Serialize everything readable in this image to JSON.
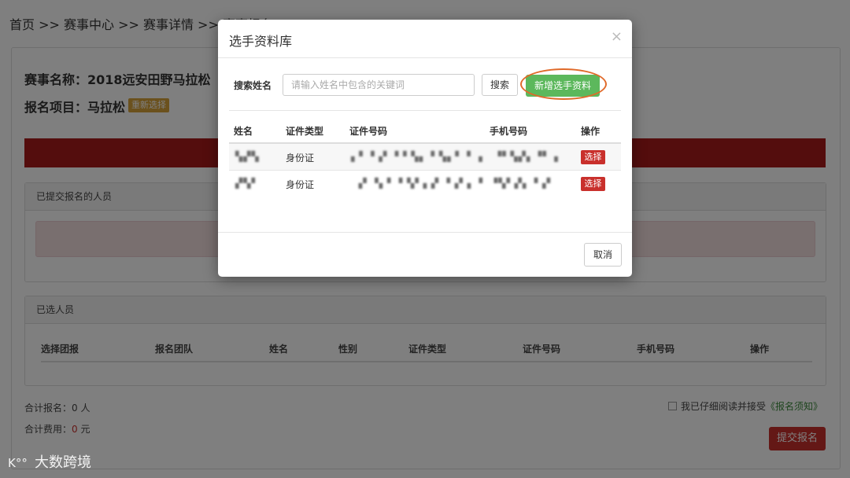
{
  "breadcrumb": "首页 >> 赛事中心 >> 赛事详情 >> 赛事报名",
  "event": {
    "name_line": "赛事名称：2018远安田野马拉松",
    "item_line": "报名项目：马拉松",
    "reselect_label": "重新选择"
  },
  "submitted_panel": {
    "title": "已提交报名的人员"
  },
  "selected_panel": {
    "title": "已选人员",
    "columns": [
      "选择团报",
      "报名团队",
      "姓名",
      "性别",
      "证件类型",
      "证件号码",
      "手机号码",
      "操作"
    ]
  },
  "totals": {
    "count_prefix": "合计报名：",
    "count_value": "0",
    "count_unit": " 人",
    "fee_prefix": "合计费用：",
    "fee_value": "0",
    "fee_unit": " 元"
  },
  "agreement": {
    "text": "我已仔细阅读并接受",
    "link": "《报名须知》"
  },
  "submit_label": "提交报名",
  "modal": {
    "title": "选手资料库",
    "close_glyph": "×",
    "search_label": "搜索姓名",
    "search_placeholder": "请输入姓名中包含的关键词",
    "search_button": "搜索",
    "add_button": "新增选手资料",
    "columns": [
      "姓名",
      "证件类型",
      "证件号码",
      "手机号码",
      "操作"
    ],
    "rows": [
      {
        "name": "▚▞▚",
        "id_type": "身份证",
        "id_no": "▖▘▝▗▘▝ ▘▚▖▝ ▚▖▘▝ ▗",
        "phone": "▝▘▚▞▖▝▘▗",
        "action": "选择"
      },
      {
        "name": "▞▚▘",
        "id_type": "身份证",
        "id_no": "▗▘▝▖▘▝ ▚▘▖▞ ▝▗▘▖▝",
        "phone": "▝▚▘▞▖▝▗▘",
        "action": "选择"
      }
    ],
    "cancel_button": "取消"
  },
  "watermark": {
    "logo_text": "K°°",
    "text": "大数跨境"
  },
  "colors": {
    "danger": "#c9302c",
    "success": "#5cb85c",
    "warning": "#d6a23b",
    "banner": "#a81b1b",
    "highlight_ring": "#e06a2a"
  }
}
